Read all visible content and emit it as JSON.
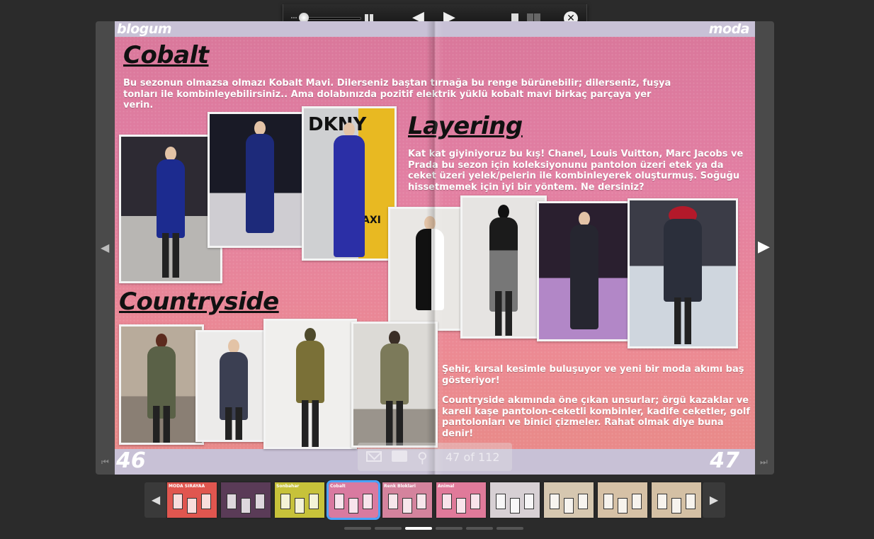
{
  "viewer": {
    "page_indicator": "47 of 112",
    "zoom_fraction": 0.05
  },
  "spread": {
    "left": {
      "brand": "blogum",
      "page_number": "46",
      "cobalt": {
        "title": "Cobalt",
        "text": "Bu sezonun olmazsa olmazı Kobalt Mavi. Dilerseniz baştan tırnağa bu renge bürünebilir; dilerseniz, fuşya tonları ile kombinleyebilirsiniz.. Ama dolabınızda pozitif elektrik yüklü kobalt mavi birkaç parçaya yer verin."
      },
      "countryside": {
        "title": "Countryside"
      }
    },
    "right": {
      "brand": "moda",
      "page_number": "47",
      "layering": {
        "title": "Layering",
        "text": "Kat kat giyiniyoruz bu kış! Chanel, Louis Vuitton, Marc Jacobs ve Prada bu sezon için koleksiyonunu pantolon üzeri etek ya da ceket üzeri yelek/pelerin ile kombinleyerek oluşturmuş. Soğuğu hissetmemek için iyi bir yöntem. Ne dersiniz?"
      },
      "countryside": {
        "text1": "Şehir, kırsal kesimle buluşuyor ve yeni bir moda akımı baş gösteriyor!",
        "text2": "Countryside akımında öne çıkan unsurlar; örgü kazaklar ve kareli kaşe pantolon-ceketli kombinler, kadife ceketler, golf pantolonları ve binici çizmeler. Rahat olmak diye buna denir!"
      }
    },
    "photo_sign": "DKNY",
    "photo_sign2": "AXI"
  },
  "thumbnails": [
    {
      "label": "MODA SIRAYAA",
      "color": "#e0564f"
    },
    {
      "label": "",
      "color": "#5a3b57"
    },
    {
      "label": "Sonbahar",
      "color": "#c7c23a"
    },
    {
      "label": "Cobalt",
      "color": "#d97aa0"
    },
    {
      "label": "Renk Bloklari",
      "color": "#d4839d"
    },
    {
      "label": "Animal",
      "color": "#e07a9a"
    },
    {
      "label": "",
      "color": "#d7d0d4"
    },
    {
      "label": "",
      "color": "#d6c7b0"
    },
    {
      "label": "",
      "color": "#d6c1a6"
    },
    {
      "label": "",
      "color": "#d4c0a4"
    }
  ],
  "active_thumbnail": 3,
  "pager_active": 2
}
